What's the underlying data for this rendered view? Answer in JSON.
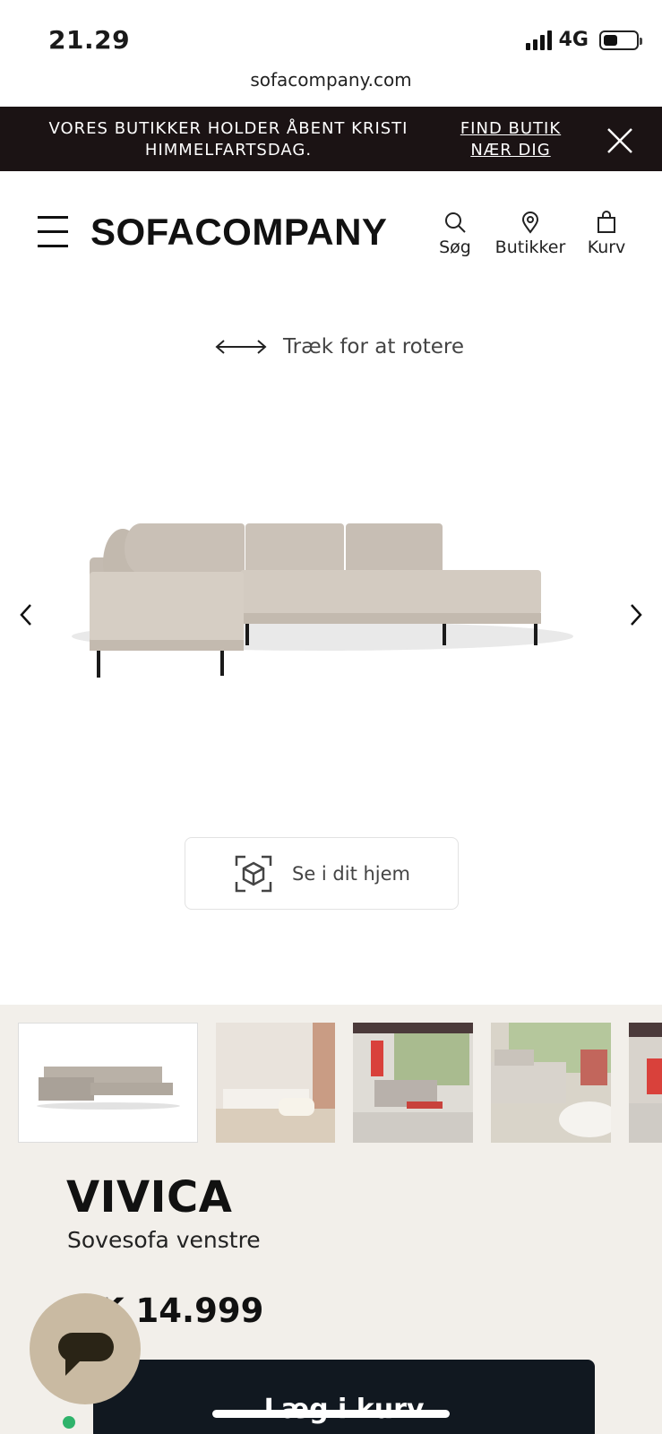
{
  "status_bar": {
    "time": "21.29",
    "network": "4G",
    "battery_level": 0.45,
    "url": "sofacompany.com"
  },
  "banner": {
    "text": "VORES BUTIKKER HOLDER ÅBENT KRISTI HIMMELFARTSDAG.",
    "link": "FIND BUTIK NÆR DIG",
    "background": "#1b1314"
  },
  "header": {
    "logo": "SOFACOMPANY",
    "nav": [
      {
        "label": "Søg",
        "icon": "search-icon"
      },
      {
        "label": "Butikker",
        "icon": "location-pin-icon"
      },
      {
        "label": "Kurv",
        "icon": "shopping-bag-icon"
      }
    ]
  },
  "viewer": {
    "rotate_hint": "Træk for at rotere",
    "ar_button": "Se i dit hjem"
  },
  "product": {
    "name": "VIVICA",
    "subtitle": "Sovesofa venstre",
    "price": "K 14.999",
    "price_note": "...",
    "cart_button": "Læg i kurv"
  },
  "colors": {
    "section_bg": "#f2efea",
    "cart_button": "#111820",
    "chat_bubble": "#c9baa2",
    "sofa_fabric": "#cfc6bc"
  }
}
